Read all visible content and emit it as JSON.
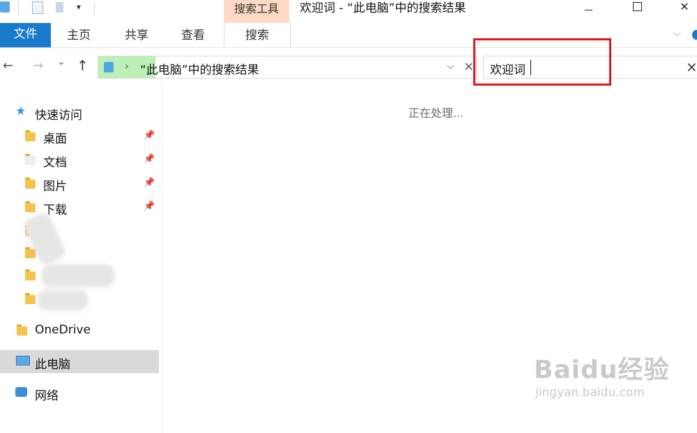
{
  "window": {
    "title": "欢迎词 - “此电脑”中的搜索结果",
    "context_tab_group": "搜索工具",
    "buttons": {
      "minimize": "—",
      "maximize": "☐",
      "close": "✕"
    }
  },
  "ribbon": {
    "tabs": [
      "文件",
      "主页",
      "共享",
      "查看",
      "搜索"
    ],
    "active_tab": "文件"
  },
  "navbar": {
    "back": "←",
    "forward": "→",
    "recent": "⌄",
    "up": "↑",
    "address": "“此电脑”中的搜索结果",
    "address_progress_color": "#bdf0b8",
    "search_value": "欢迎词",
    "search_clear": "×"
  },
  "sidebar": {
    "quick_access": "快速访问",
    "items": [
      {
        "label": "桌面",
        "pinned": true
      },
      {
        "label": "文档",
        "pinned": true
      },
      {
        "label": "图片",
        "pinned": true
      },
      {
        "label": "下载",
        "pinned": true
      }
    ],
    "onedrive": "OneDrive",
    "this_pc": "此电脑",
    "network": "网络"
  },
  "content": {
    "status": "正在处理..."
  },
  "watermark": {
    "brand": "Baidu经验",
    "url": "jingyan.baidu.com"
  },
  "colors": {
    "file_tab": "#1979ca",
    "context_tab": "#fcd9c4",
    "highlight": "#e8101a",
    "selected_nav": "#d9d9d9"
  }
}
